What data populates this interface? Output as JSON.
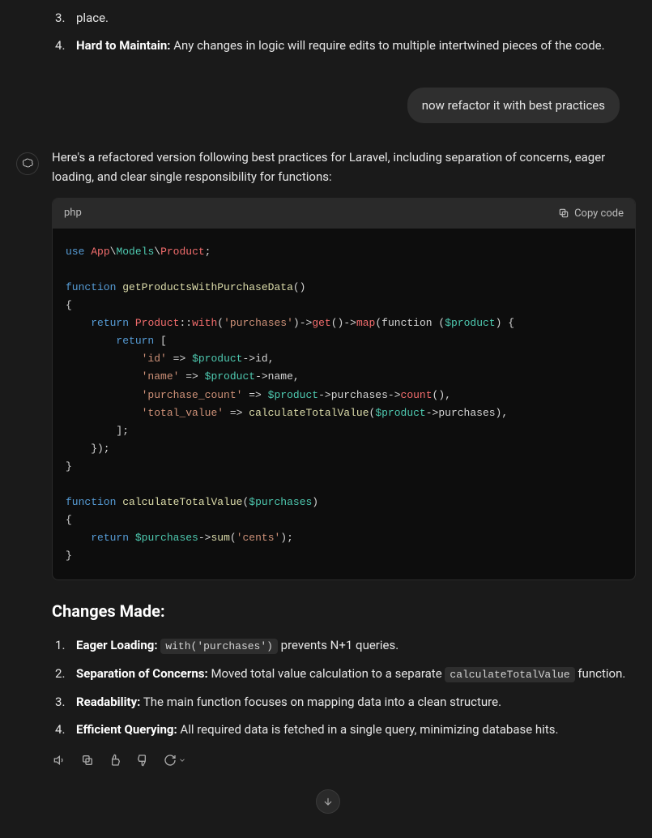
{
  "prior_list": {
    "item4": {
      "title": "Hard to Maintain:",
      "body": " Any changes in logic will require edits to multiple intertwined pieces of the code."
    },
    "item3_tail": "place."
  },
  "user_prompt": "now refactor it with best practices",
  "assistant_intro": "Here's a refactored version following best practices for Laravel, including separation of concerns, eager loading, and clear single responsibility for functions:",
  "code_lang": "php",
  "copy_label": "Copy code",
  "code": {
    "l1": {
      "use": "use",
      "app": "App",
      "bs1": "\\",
      "models": "Models",
      "bs2": "\\",
      "product": "Product",
      "semi": ";"
    },
    "l3": {
      "fn": "function",
      "name": "getProductsWithPurchaseData",
      "paren": "()"
    },
    "l4": "{",
    "l5": {
      "ret": "return",
      "product": "Product",
      "dcolon": "::",
      "with": "with",
      "op": "(",
      "str": "'purchases'",
      "cp": ")->",
      "get": "get",
      "op2": "()->",
      "map": "map",
      "rest": "(function (",
      "var": "$product",
      "rest2": ") {"
    },
    "l6": {
      "ret": "return",
      "br": " ["
    },
    "l7": {
      "key": "'id'",
      "arrow": " => ",
      "var": "$product",
      "rest": "->id,"
    },
    "l8": {
      "key": "'name'",
      "arrow": " => ",
      "var": "$product",
      "rest": "->name,"
    },
    "l9": {
      "key": "'purchase_count'",
      "arrow": " => ",
      "var": "$product",
      "rest1": "->purchases->",
      "count": "count",
      "rest2": "(),"
    },
    "l10": {
      "key": "'total_value'",
      "arrow": " => ",
      "fn": "calculateTotalValue",
      "op": "(",
      "var": "$product",
      "rest": "->purchases),"
    },
    "l11": "        ];",
    "l12": "    });",
    "l13": "}",
    "l15": {
      "fn": "function",
      "name": "calculateTotalValue",
      "op": "(",
      "var": "$purchases",
      "cp": ")"
    },
    "l16": "{",
    "l17": {
      "ret": "return",
      "var": "$purchases",
      "arrow": "->",
      "sum": "sum",
      "op": "(",
      "str": "'cents'",
      "cp": ");"
    },
    "l18": "}"
  },
  "changes_heading": "Changes Made:",
  "changes": [
    {
      "title": "Eager Loading:",
      "code": "with('purchases')",
      "body": " prevents N+1 queries."
    },
    {
      "title": "Separation of Concerns:",
      "body_pre": " Moved total value calculation to a separate ",
      "code": "calculateTotalValue",
      "body_post": " function."
    },
    {
      "title": "Readability:",
      "body": " The main function focuses on mapping data into a clean structure."
    },
    {
      "title": "Efficient Querying:",
      "body": " All required data is fetched in a single query, minimizing database hits."
    }
  ]
}
